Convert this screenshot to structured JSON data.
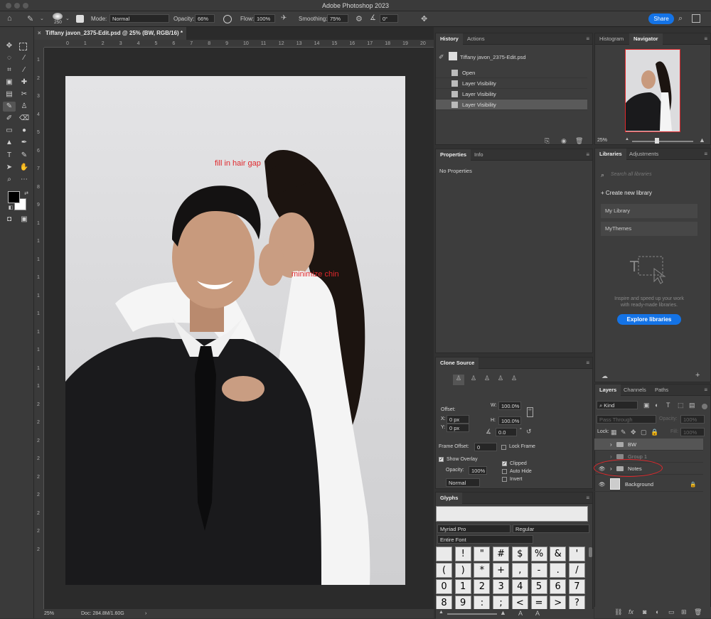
{
  "app": {
    "title": "Adobe Photoshop 2023"
  },
  "options": {
    "mode_label": "Mode:",
    "mode_value": "Normal",
    "opacity_label": "Opacity:",
    "opacity_value": "66%",
    "flow_label": "Flow:",
    "flow_value": "100%",
    "smoothing_label": "Smoothing:",
    "smoothing_value": "75%",
    "angle_value": "0°",
    "brush_size": "250",
    "share_label": "Share"
  },
  "document": {
    "tab_title": "Tiffany javon_2375-Edit.psd @ 25% (BW, RGB/16) *",
    "zoom": "25%",
    "doc_size": "Doc: 284.8M/1.60G",
    "annotations": [
      "fill in hair gap",
      "minimize chin"
    ]
  },
  "rulers": {
    "h": [
      "0",
      "1",
      "2",
      "3",
      "4",
      "5",
      "6",
      "7",
      "8",
      "9",
      "10",
      "11",
      "12",
      "13",
      "14",
      "15",
      "16",
      "17",
      "18",
      "19",
      "20"
    ],
    "v": [
      "1",
      "2",
      "3",
      "4",
      "5",
      "6",
      "7",
      "8",
      "9",
      "1",
      "1",
      "1",
      "1",
      "1",
      "1",
      "1",
      "1",
      "1",
      "1",
      "2",
      "2",
      "2",
      "2",
      "2",
      "2",
      "2",
      "2",
      "2"
    ]
  },
  "history": {
    "tabs": [
      "History",
      "Actions"
    ],
    "snapshot": "Tiffany javon_2375-Edit.psd",
    "items": [
      "Open",
      "Layer Visibility",
      "Layer Visibility",
      "Layer Visibility"
    ]
  },
  "properties": {
    "tabs": [
      "Properties",
      "Info"
    ],
    "empty": "No Properties"
  },
  "clone": {
    "tab": "Clone Source",
    "offset_label": "Offset:",
    "x_label": "X:",
    "x_value": "0 px",
    "y_label": "Y:",
    "y_value": "0 px",
    "w_label": "W:",
    "w_value": "100.0%",
    "h_label": "H:",
    "h_value": "100.0%",
    "angle_value": "0.0",
    "angle_unit": "°",
    "frame_offset_label": "Frame Offset:",
    "frame_offset_value": "0",
    "lock_frame": "Lock Frame",
    "show_overlay": "Show Overlay",
    "opacity_label": "Opacity:",
    "opacity_value": "100%",
    "blend": "Normal",
    "clipped": "Clipped",
    "auto_hide": "Auto Hide",
    "invert": "Invert"
  },
  "glyphs": {
    "tab": "Glyphs",
    "font": "Myriad Pro",
    "style": "Regular",
    "filter": "Entire Font",
    "rows": [
      [
        "",
        "!",
        "\"",
        "#",
        "$",
        "%",
        "&",
        "'"
      ],
      [
        "(",
        ")",
        "*",
        "+",
        ",",
        "-",
        ".",
        "/"
      ],
      [
        "0",
        "1",
        "2",
        "3",
        "4",
        "5",
        "6",
        "7"
      ],
      [
        "8",
        "9",
        ":",
        ";",
        "<",
        "=",
        ">",
        "?"
      ]
    ]
  },
  "navigator": {
    "tabs": [
      "Histogram",
      "Navigator"
    ],
    "zoom": "25%"
  },
  "libraries": {
    "tabs": [
      "Libraries",
      "Adjustments"
    ],
    "search_placeholder": "Search all libraries",
    "create": "Create new library",
    "items": [
      "My Library",
      "MyThemes"
    ],
    "promo_line1": "Inspire and speed up your work",
    "promo_line2": "with ready-made libraries.",
    "explore": "Explore libraries"
  },
  "layers": {
    "tabs": [
      "Layers",
      "Channels",
      "Paths"
    ],
    "kind": "Kind",
    "blend": "Pass Through",
    "opacity_label": "Opacity:",
    "opacity_value": "100%",
    "lock_label": "Lock:",
    "fill_label": "Fill:",
    "fill_value": "100%",
    "items": [
      "BW",
      "Group 1",
      "Notes",
      "Background"
    ]
  },
  "colors": {
    "accent": "#1473e6",
    "annotation": "#e0282c"
  }
}
